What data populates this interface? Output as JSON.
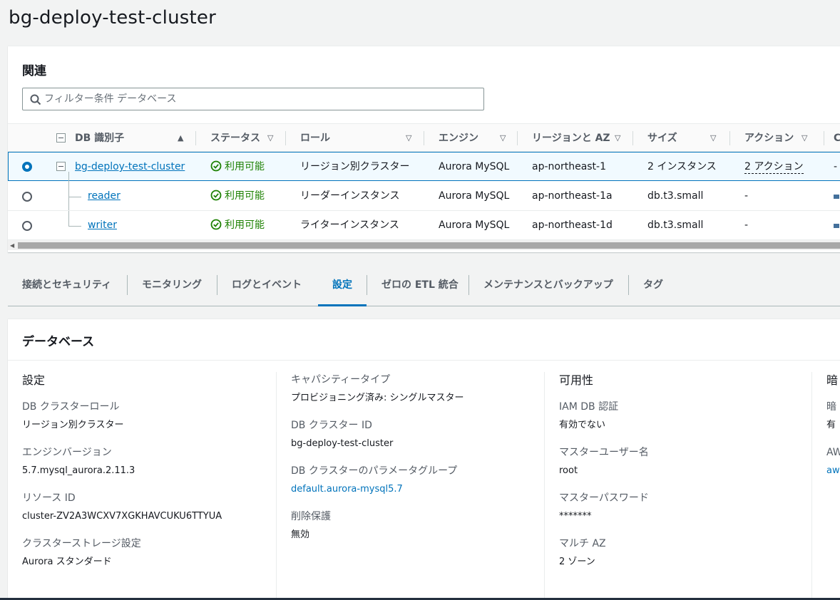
{
  "page_title": "bg-deploy-test-cluster",
  "related": {
    "heading": "関連",
    "filter_placeholder": "フィルター条件 データベース",
    "columns": {
      "db_id": "DB 識別子",
      "status": "ステータス",
      "role": "ロール",
      "engine": "エンジン",
      "region": "リージョンと AZ",
      "size": "サイズ",
      "actions": "アクション",
      "cut": "C"
    },
    "rows": [
      {
        "id": "bg-deploy-test-cluster",
        "status": "利用可能",
        "role": "リージョン別クラスター",
        "engine": "Aurora MySQL",
        "region": "ap-northeast-1",
        "size": "2 インスタンス",
        "actions": "2 アクション",
        "extra": "-"
      },
      {
        "id": "reader",
        "status": "利用可能",
        "role": "リーダーインスタンス",
        "engine": "Aurora MySQL",
        "region": "ap-northeast-1a",
        "size": "db.t3.small",
        "actions": "-"
      },
      {
        "id": "writer",
        "status": "利用可能",
        "role": "ライターインスタンス",
        "engine": "Aurora MySQL",
        "region": "ap-northeast-1d",
        "size": "db.t3.small",
        "actions": "-"
      }
    ]
  },
  "tabs": [
    "接続とセキュリティ",
    "モニタリング",
    "ログとイベント",
    "設定",
    "ゼロの ETL 統合",
    "メンテナンスとバックアップ",
    "タグ"
  ],
  "active_tab": "設定",
  "database": {
    "heading": "データベース",
    "col1": {
      "title": "設定",
      "items": [
        {
          "k": "DB クラスターロール",
          "v": "リージョン別クラスター"
        },
        {
          "k": "エンジンバージョン",
          "v": "5.7.mysql_aurora.2.11.3"
        },
        {
          "k": "リソース ID",
          "v": "cluster-ZV2A3WCXV7XGKHAVCUKU6TTYUA"
        },
        {
          "k": "クラスターストレージ設定",
          "v": "Aurora スタンダード"
        }
      ]
    },
    "col2": {
      "items": [
        {
          "k": "キャパシティータイプ",
          "v": "プロビジョニング済み: シングルマスター"
        },
        {
          "k": "DB クラスター ID",
          "v": "bg-deploy-test-cluster"
        },
        {
          "k": "DB クラスターのパラメータグループ",
          "v": "default.aurora-mysql5.7"
        },
        {
          "k": "削除保護",
          "v": "無効"
        }
      ]
    },
    "col3": {
      "title": "可用性",
      "items": [
        {
          "k": "IAM DB 認証",
          "v": "有効でない"
        },
        {
          "k": "マスターユーザー名",
          "v": "root"
        },
        {
          "k": "マスターパスワード",
          "v": "*******"
        },
        {
          "k": "マルチ AZ",
          "v": "2 ゾーン"
        }
      ]
    },
    "col4": {
      "title": "暗",
      "items": [
        {
          "k": "暗",
          "v": "有"
        },
        {
          "k": "AW",
          "v": "aw"
        }
      ]
    }
  },
  "colors": {
    "accent": "#0073bb",
    "success": "#1d8102"
  }
}
